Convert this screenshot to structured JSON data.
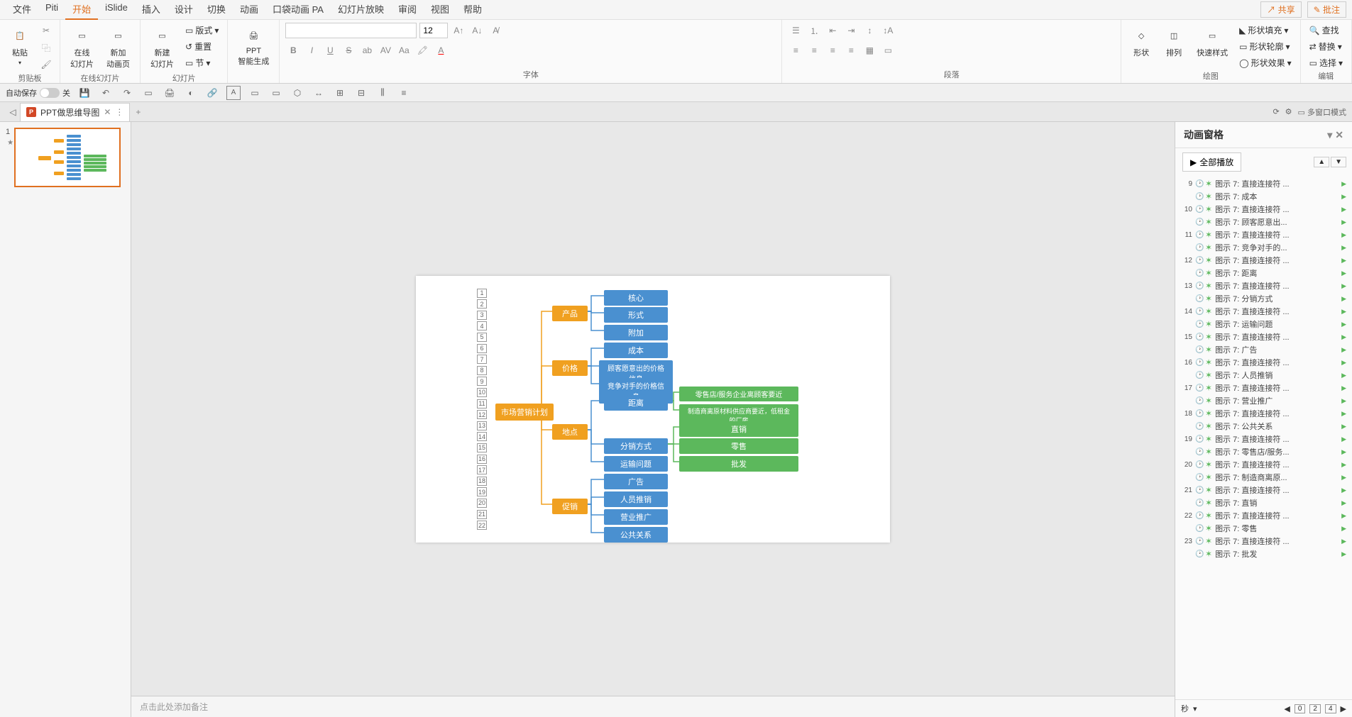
{
  "menubar": {
    "items": [
      "文件",
      "Piti",
      "开始",
      "iSlide",
      "插入",
      "设计",
      "切换",
      "动画",
      "口袋动画 PA",
      "幻灯片放映",
      "审阅",
      "视图",
      "帮助"
    ],
    "active_index": 2,
    "share": "共享",
    "comment": "批注"
  },
  "ribbon": {
    "clipboard": {
      "paste": "粘贴",
      "group": "剪贴板"
    },
    "online_slides": {
      "online": "在线\n幻灯片",
      "new_anim": "新加\n动画页",
      "group": "在线幻灯片"
    },
    "slides": {
      "new_slide": "新建\n幻灯片",
      "layout": "版式",
      "reset": "重置",
      "section": "节",
      "group": "幻灯片"
    },
    "ppt_ai": {
      "label": "PPT\n智能生成"
    },
    "font": {
      "size": "12",
      "group": "字体"
    },
    "paragraph": {
      "group": "段落"
    },
    "drawing": {
      "shape": "形状",
      "arrange": "排列",
      "quick_style": "快速样式",
      "fill": "形状填充",
      "outline": "形状轮廓",
      "effects": "形状效果",
      "group": "绘图"
    },
    "editing": {
      "find": "查找",
      "replace": "替换",
      "select": "选择",
      "group": "编辑"
    }
  },
  "qat": {
    "auto_save": "自动保存",
    "auto_save_state": "关"
  },
  "tab": {
    "name": "PPT做思维导图",
    "multi_window": "多窗口模式"
  },
  "notes_placeholder": "点击此处添加备注",
  "mindmap": {
    "root": "市场营销计划",
    "level2": [
      "产品",
      "价格",
      "地点",
      "促销"
    ],
    "product": [
      "核心",
      "形式",
      "附加"
    ],
    "price": [
      "成本",
      "顾客愿意出的价格信息",
      "竞争对手的价格信息"
    ],
    "place": [
      "距离",
      "分销方式",
      "运输问题"
    ],
    "distance": [
      "零售店/服务企业离顾客要近",
      "制造商离原材料供应商要近，低租金的厂房"
    ],
    "distribution": [
      "直销",
      "零售",
      "批发"
    ],
    "promotion": [
      "广告",
      "人员推销",
      "营业推广",
      "公共关系"
    ]
  },
  "anim_pane": {
    "title": "动画窗格",
    "play_all": "全部播放",
    "seconds": "秒",
    "items": [
      {
        "n": "9",
        "t": "图示 7: 直接连接符 ..."
      },
      {
        "n": "",
        "t": "图示 7: 成本"
      },
      {
        "n": "10",
        "t": "图示 7: 直接连接符 ..."
      },
      {
        "n": "",
        "t": "图示 7: 顾客愿意出..."
      },
      {
        "n": "11",
        "t": "图示 7: 直接连接符 ..."
      },
      {
        "n": "",
        "t": "图示 7: 竞争对手的..."
      },
      {
        "n": "12",
        "t": "图示 7: 直接连接符 ..."
      },
      {
        "n": "",
        "t": "图示 7: 距离"
      },
      {
        "n": "13",
        "t": "图示 7: 直接连接符 ..."
      },
      {
        "n": "",
        "t": "图示 7: 分销方式"
      },
      {
        "n": "14",
        "t": "图示 7: 直接连接符 ..."
      },
      {
        "n": "",
        "t": "图示 7: 运输问题"
      },
      {
        "n": "15",
        "t": "图示 7: 直接连接符 ..."
      },
      {
        "n": "",
        "t": "图示 7: 广告"
      },
      {
        "n": "16",
        "t": "图示 7: 直接连接符 ..."
      },
      {
        "n": "",
        "t": "图示 7: 人员推销"
      },
      {
        "n": "17",
        "t": "图示 7: 直接连接符 ..."
      },
      {
        "n": "",
        "t": "图示 7: 营业推广"
      },
      {
        "n": "18",
        "t": "图示 7: 直接连接符 ..."
      },
      {
        "n": "",
        "t": "图示 7: 公共关系"
      },
      {
        "n": "19",
        "t": "图示 7: 直接连接符 ..."
      },
      {
        "n": "",
        "t": "图示 7: 零售店/服务..."
      },
      {
        "n": "20",
        "t": "图示 7: 直接连接符 ..."
      },
      {
        "n": "",
        "t": "图示 7: 制造商离原..."
      },
      {
        "n": "21",
        "t": "图示 7: 直接连接符 ..."
      },
      {
        "n": "",
        "t": "图示 7: 直销"
      },
      {
        "n": "22",
        "t": "图示 7: 直接连接符 ..."
      },
      {
        "n": "",
        "t": "图示 7: 零售"
      },
      {
        "n": "23",
        "t": "图示 7: 直接连接符 ..."
      },
      {
        "n": "",
        "t": "图示 7: 批发"
      }
    ],
    "timeline": [
      "0",
      "2",
      "4"
    ]
  },
  "thumb_number": "1"
}
